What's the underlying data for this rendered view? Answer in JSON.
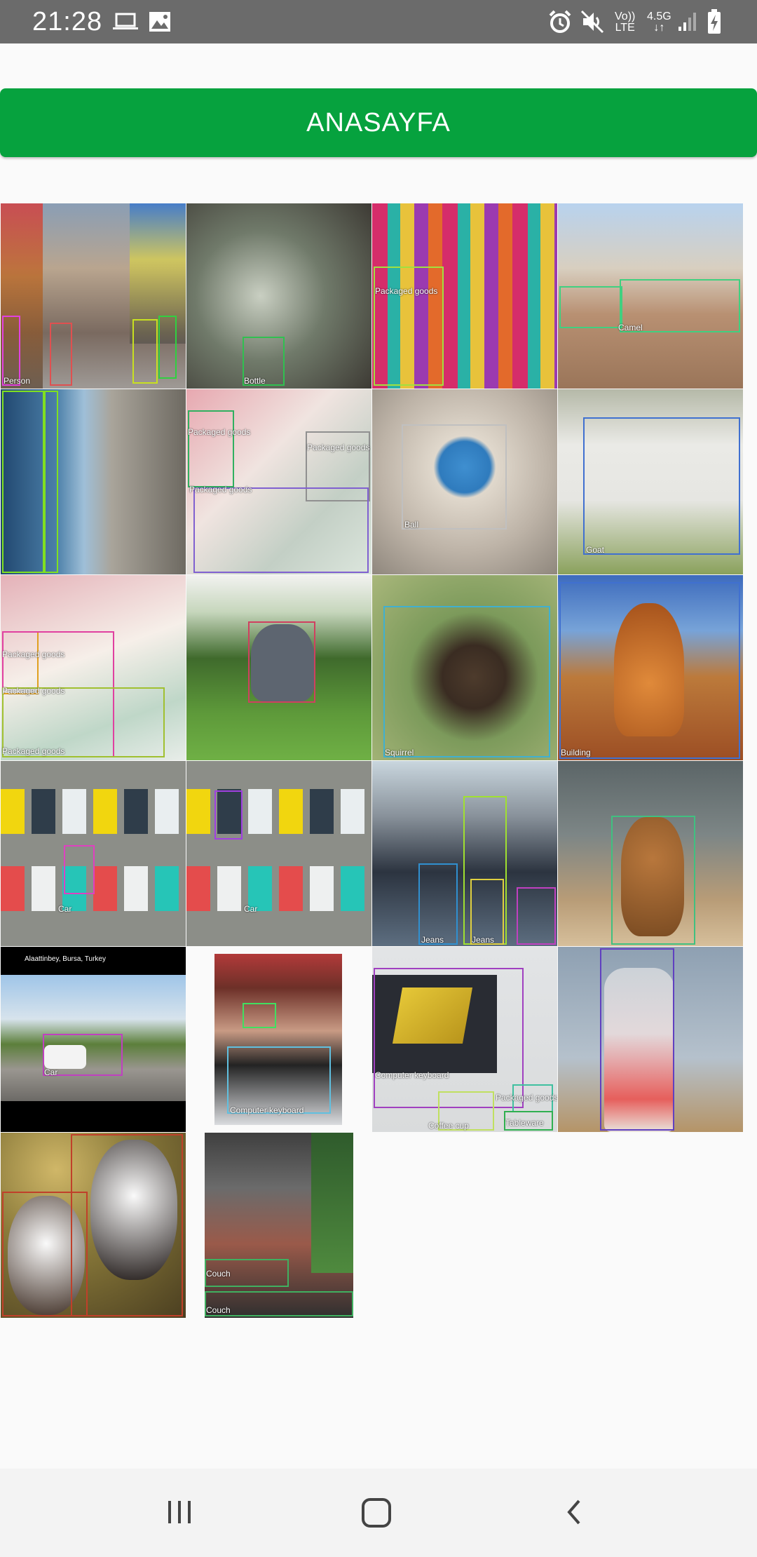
{
  "status_bar": {
    "time": "21:28",
    "icons": [
      "laptop-icon",
      "image-icon",
      "alarm-icon",
      "mute-icon",
      "volte-icon",
      "data-45g-icon",
      "signal-icon",
      "battery-charging-icon"
    ],
    "volte_label_top": "Vo))",
    "volte_label_bottom": "LTE",
    "data_label": "4.5G"
  },
  "header": {
    "button_label": "ANASAYFA",
    "button_color": "#06a23e"
  },
  "grid": {
    "tiles": [
      {
        "id": "street",
        "labels": [
          "Person"
        ]
      },
      {
        "id": "garbage",
        "labels": [
          "Bottle"
        ]
      },
      {
        "id": "fabrics",
        "labels": [
          "Packaged goods"
        ]
      },
      {
        "id": "camels",
        "labels": [
          "Camel"
        ]
      },
      {
        "id": "statue",
        "labels": []
      },
      {
        "id": "money-notebook",
        "labels": [
          "Packaged goods",
          "Packaged goods",
          "Packaged goods"
        ]
      },
      {
        "id": "globe",
        "labels": [
          "Ball"
        ]
      },
      {
        "id": "goat",
        "labels": [
          "Goat"
        ]
      },
      {
        "id": "money-pen",
        "labels": [
          "Packaged goods",
          "Packaged goods",
          "Packaged goods"
        ]
      },
      {
        "id": "sculpture",
        "labels": []
      },
      {
        "id": "squirrel",
        "labels": [
          "Squirrel"
        ]
      },
      {
        "id": "teapot",
        "labels": [
          "Building"
        ]
      },
      {
        "id": "cars-1",
        "labels": [
          "Car"
        ]
      },
      {
        "id": "cars-2",
        "labels": [
          "Car"
        ]
      },
      {
        "id": "men",
        "labels": [
          "Jeans",
          "Jeans"
        ]
      },
      {
        "id": "cat",
        "labels": []
      },
      {
        "id": "forklift",
        "labels": [
          "Car"
        ],
        "caption": "Alaattinbey, Bursa, Turkey"
      },
      {
        "id": "laptop-person",
        "labels": [
          "Computer keyboard"
        ]
      },
      {
        "id": "laptop-desk",
        "labels": [
          "Computer keyboard",
          "Coffee cup",
          "Packaged goods",
          "Tableware"
        ]
      },
      {
        "id": "bottle",
        "labels": []
      },
      {
        "id": "dogs",
        "labels": []
      },
      {
        "id": "cafe",
        "labels": [
          "Couch",
          "Couch"
        ]
      }
    ]
  },
  "nav_bar": {
    "icons": [
      "recent-apps-icon",
      "home-icon",
      "back-icon"
    ]
  }
}
